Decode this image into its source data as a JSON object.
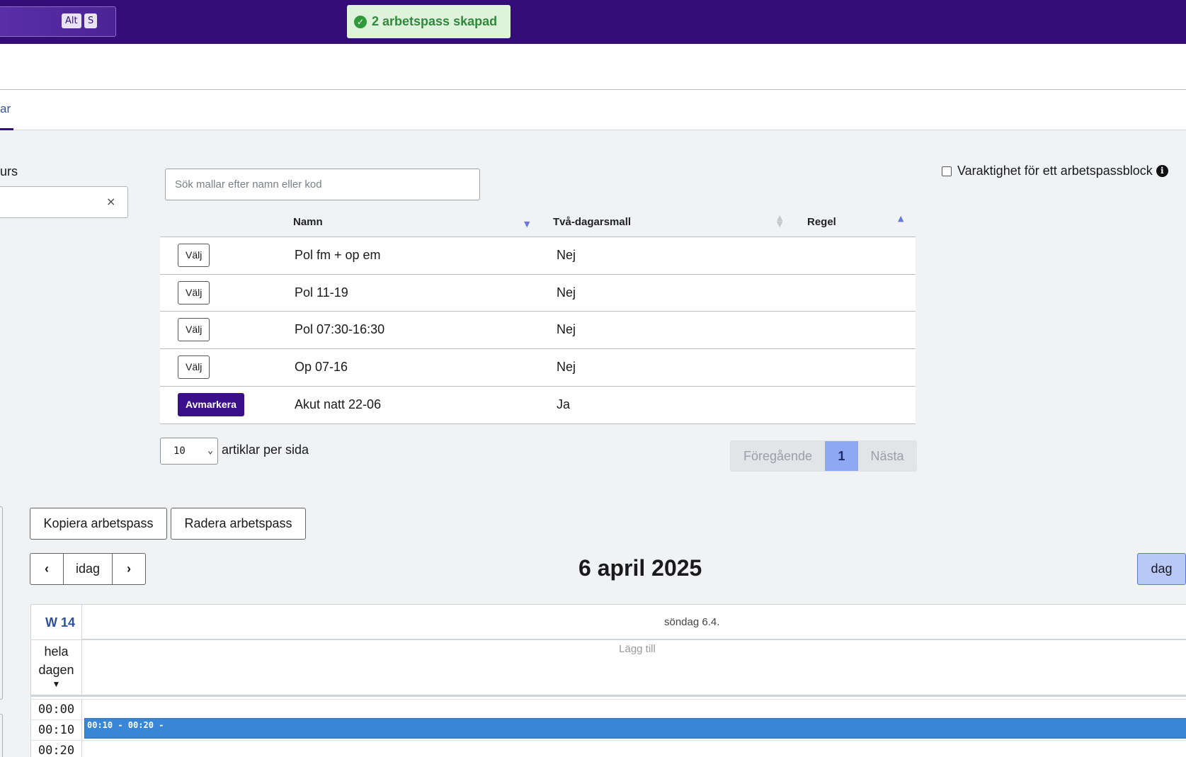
{
  "topbar": {
    "shortcut_keys": [
      "Alt",
      "S"
    ],
    "toast": "2 arbetspass skapad"
  },
  "tabs": {
    "active_label": "ar"
  },
  "resource": {
    "label": "urs",
    "clear_icon": "×"
  },
  "templates": {
    "search_placeholder": "Sök mallar efter namn eller kod",
    "duration_label": "Varaktighet för ett arbetspassblock",
    "columns": {
      "name": "Namn",
      "two_day": "Två-dagarsmall",
      "rule": "Regel"
    },
    "rows": [
      {
        "action": "Välj",
        "name": "Pol fm + op em",
        "two_day": "Nej",
        "selected": false
      },
      {
        "action": "Välj",
        "name": "Pol 11-19",
        "two_day": "Nej",
        "selected": false
      },
      {
        "action": "Välj",
        "name": "Pol 07:30-16:30",
        "two_day": "Nej",
        "selected": false
      },
      {
        "action": "Välj",
        "name": "Op 07-16",
        "two_day": "Nej",
        "selected": false
      },
      {
        "action": "Avmarkera",
        "name": "Akut natt 22-06",
        "two_day": "Ja",
        "selected": true
      }
    ],
    "per_page_value": "10",
    "per_page_label": "artiklar per sida",
    "pager": {
      "prev": "Föregående",
      "current": "1",
      "next": "Nästa"
    }
  },
  "calendar": {
    "copy_button": "Kopiera arbetspass",
    "delete_button": "Radera arbetspass",
    "today_button": "idag",
    "title": "6 april 2025",
    "view_day": "dag",
    "week_label": "W 14",
    "day_header": "söndag 6.4.",
    "allday_label_1": "hela",
    "allday_label_2": "dagen",
    "add_label": "Lägg till",
    "time_slots": [
      "00:00",
      "00:10",
      "00:20"
    ],
    "event_label": "00:10 - 00:20 -"
  },
  "colors": {
    "topbar": "#340d78",
    "accent": "#3b0e8c",
    "event": "#3a86d6"
  }
}
